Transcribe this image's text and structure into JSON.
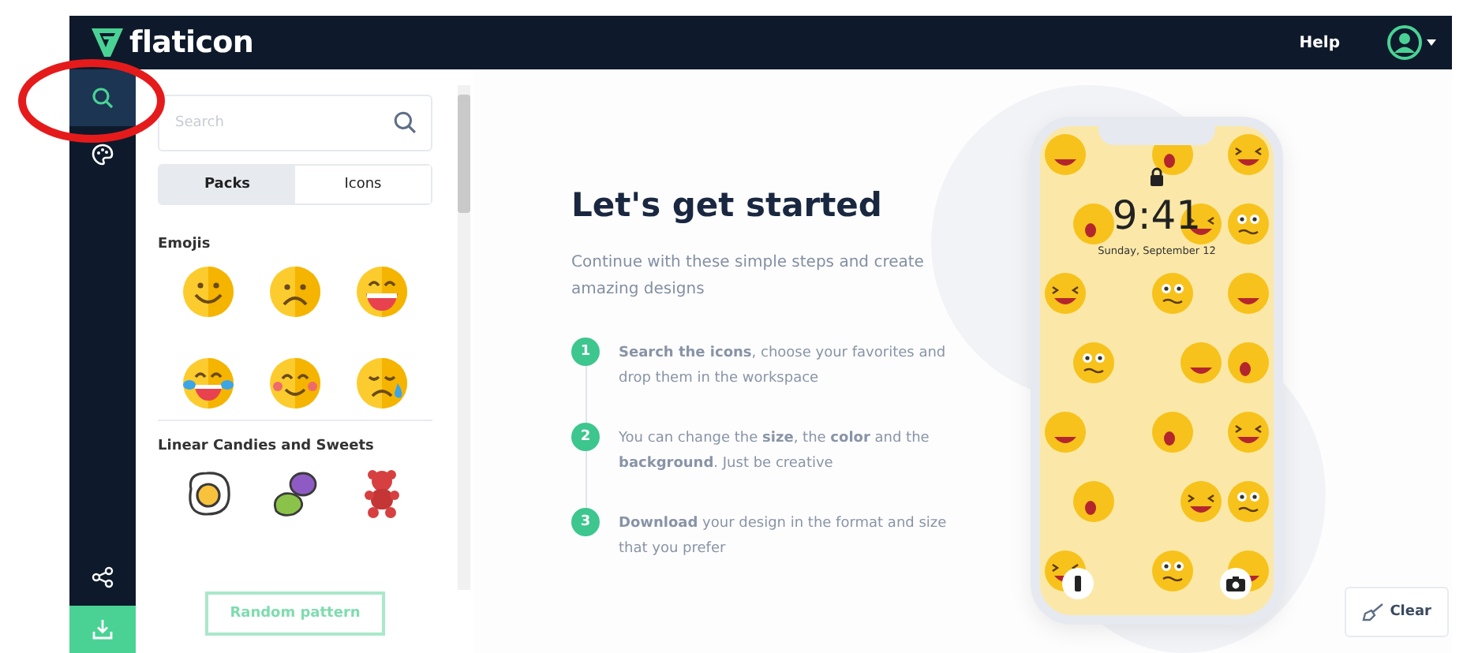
{
  "topbar": {
    "logo": "flaticon",
    "help": "Help"
  },
  "rail": [
    {
      "kind": "search",
      "selected": true
    },
    {
      "kind": "palette",
      "selected": false
    },
    {
      "kind": "share",
      "selected": false
    },
    {
      "kind": "download",
      "selected": false
    }
  ],
  "panel": {
    "search": {
      "placeholder": "Search"
    },
    "tabs": [
      {
        "label": "Packs",
        "selected": true
      },
      {
        "label": "Icons",
        "selected": false
      }
    ],
    "packs": [
      {
        "kind": "emoji",
        "title": "Emojis"
      },
      {
        "kind": "candy",
        "title": "Linear Candies and Sweets"
      }
    ],
    "random_button": "Random pattern"
  },
  "main": {
    "title": "Let's get started",
    "subtitle": "Continue with these simple steps and create amazing designs",
    "steps": [
      {
        "number": "1",
        "text": "**Search the icons**, choose your favorites and drop them in the workspace"
      },
      {
        "number": "2",
        "text": "You can change the **size**, the **color** and the **background**. Just be creative"
      },
      {
        "number": "3",
        "text": "**Download** your design in the format and size that you prefer"
      }
    ]
  },
  "phone": {
    "time": "9:41",
    "date": "Sunday, September 12"
  },
  "clear_button": "Clear"
}
